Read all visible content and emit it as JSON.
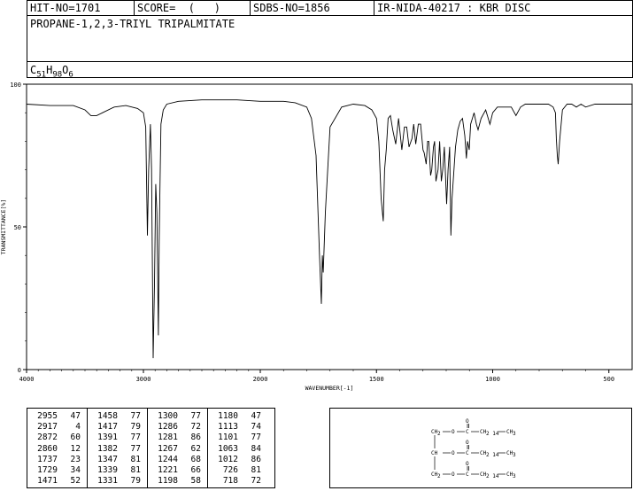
{
  "header": {
    "hit_no": "HIT-NO=1701",
    "score": "SCORE=  (   )",
    "sdbs_no": "SDBS-NO=1856",
    "ir_nida": "IR-NIDA-40217 : KBR DISC"
  },
  "compound_name": "PROPANE-1,2,3-TRIYL TRIPALMITATE",
  "formula": {
    "c": "C",
    "c_n": "51",
    "h": "H",
    "h_n": "98",
    "o": "O",
    "o_n": "6"
  },
  "chart_data": {
    "type": "line",
    "xlabel": "WAVENUMBER[-1]",
    "ylabel": "TRANSMITTANCE[%]",
    "xlim": [
      4000,
      400
    ],
    "ylim": [
      0,
      100
    ],
    "x_ticks": [
      "4000",
      "3000",
      "2000",
      "1500",
      "1000",
      "500"
    ],
    "y_ticks": [
      "100",
      "50",
      "0"
    ],
    "series": [
      {
        "x": [
          4000,
          3800,
          3600,
          3500,
          3450,
          3400,
          3350,
          3250,
          3150,
          3050,
          3000,
          2980,
          2966,
          2955,
          2940,
          2930,
          2917,
          2905,
          2895,
          2885,
          2872,
          2865,
          2860,
          2850,
          2830,
          2800,
          2700,
          2500,
          2200,
          2000,
          1900,
          1850,
          1800,
          1780,
          1760,
          1745,
          1737,
          1733,
          1729,
          1720,
          1700,
          1650,
          1600,
          1550,
          1520,
          1500,
          1490,
          1480,
          1471,
          1465,
          1458,
          1450,
          1440,
          1430,
          1417,
          1405,
          1391,
          1380,
          1370,
          1360,
          1347,
          1340,
          1331,
          1320,
          1310,
          1300,
          1295,
          1286,
          1280,
          1275,
          1267,
          1262,
          1255,
          1250,
          1244,
          1235,
          1228,
          1221,
          1215,
          1208,
          1198,
          1192,
          1185,
          1180,
          1175,
          1170,
          1160,
          1150,
          1140,
          1130,
          1120,
          1113,
          1108,
          1101,
          1095,
          1080,
          1070,
          1063,
          1050,
          1030,
          1012,
          1000,
          980,
          960,
          940,
          920,
          900,
          880,
          860,
          840,
          820,
          800,
          780,
          760,
          740,
          730,
          726,
          722,
          718,
          712,
          700,
          680,
          660,
          640,
          620,
          600,
          560,
          520,
          480,
          440,
          400
        ],
        "y": [
          93,
          92.5,
          92.5,
          91,
          89,
          89,
          90,
          92,
          92.5,
          91.5,
          90,
          85,
          47,
          70,
          86,
          70,
          4,
          30,
          65,
          55,
          12,
          45,
          60,
          86,
          91,
          93,
          94,
          94.5,
          94.5,
          94,
          94,
          93.5,
          92,
          88,
          75,
          40,
          23,
          40,
          34,
          55,
          85,
          92,
          93,
          92.5,
          91,
          88,
          80,
          60,
          52,
          70,
          77,
          88,
          89,
          84,
          79,
          88,
          77,
          85,
          85,
          78,
          81,
          86,
          79,
          86,
          86,
          77,
          76,
          72,
          80,
          80,
          68,
          70,
          78,
          80,
          66,
          70,
          80,
          66,
          70,
          78,
          58,
          70,
          78,
          47,
          60,
          66,
          78,
          84,
          87,
          88,
          82,
          74,
          80,
          77,
          86,
          90,
          86,
          84,
          88,
          91,
          86,
          90,
          92,
          92,
          92,
          92,
          89,
          92,
          93,
          93,
          93,
          93,
          93,
          93,
          92,
          90,
          81,
          75,
          72,
          80,
          91,
          93,
          93,
          92,
          93,
          92,
          93,
          93,
          93,
          93,
          93
        ]
      }
    ]
  },
  "peak_table": [
    [
      "2955",
      "47"
    ],
    [
      "2917",
      "4"
    ],
    [
      "2872",
      "60"
    ],
    [
      "2860",
      "12"
    ],
    [
      "1737",
      "23"
    ],
    [
      "1729",
      "34"
    ],
    [
      "1471",
      "52"
    ],
    [
      "1458",
      "77"
    ],
    [
      "1417",
      "79"
    ],
    [
      "1391",
      "77"
    ],
    [
      "1382",
      "77"
    ],
    [
      "1347",
      "81"
    ],
    [
      "1339",
      "81"
    ],
    [
      "1331",
      "79"
    ],
    [
      "1300",
      "77"
    ],
    [
      "1286",
      "72"
    ],
    [
      "1281",
      "86"
    ],
    [
      "1267",
      "62"
    ],
    [
      "1244",
      "68"
    ],
    [
      "1221",
      "66"
    ],
    [
      "1198",
      "58"
    ],
    [
      "1180",
      "47"
    ],
    [
      "1113",
      "74"
    ],
    [
      "1101",
      "77"
    ],
    [
      "1063",
      "84"
    ],
    [
      "1012",
      "86"
    ],
    [
      "726",
      "81"
    ],
    [
      "718",
      "72"
    ]
  ],
  "structure_labels": {
    "ch2": "CH2",
    "o": "O",
    "c": "C",
    "ch2_chain": "CH2",
    "chain_n": "14",
    "ch3": "CH3",
    "ch": "CH"
  }
}
